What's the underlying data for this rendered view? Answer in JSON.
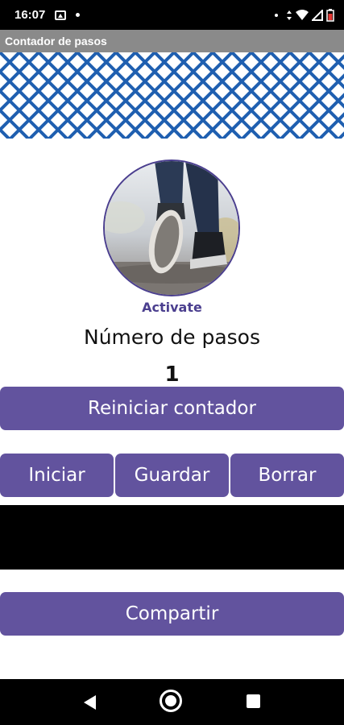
{
  "status_bar": {
    "time": "16:07",
    "icons": [
      "image-icon",
      "notification-dot-icon",
      "dot-icon",
      "data-arrows-icon",
      "wifi-icon",
      "signal-icon",
      "battery-icon"
    ]
  },
  "app_bar": {
    "title": "Contador de pasos"
  },
  "header": {
    "pattern_color": "#1f5fb0"
  },
  "main": {
    "activate_label": "Activate",
    "steps_label": "Número de pasos",
    "step_count": "1",
    "reset_button": "Reiniciar contador",
    "start_button": "Iniciar",
    "save_button": "Guardar",
    "delete_button": "Borrar",
    "share_button": "Compartir"
  },
  "colors": {
    "accent": "#62539e",
    "accent_dark": "#4b3f8f",
    "appbar": "#8a8a8a"
  },
  "nav_bar": {
    "icons": [
      "back-icon",
      "home-icon",
      "recents-icon"
    ]
  }
}
